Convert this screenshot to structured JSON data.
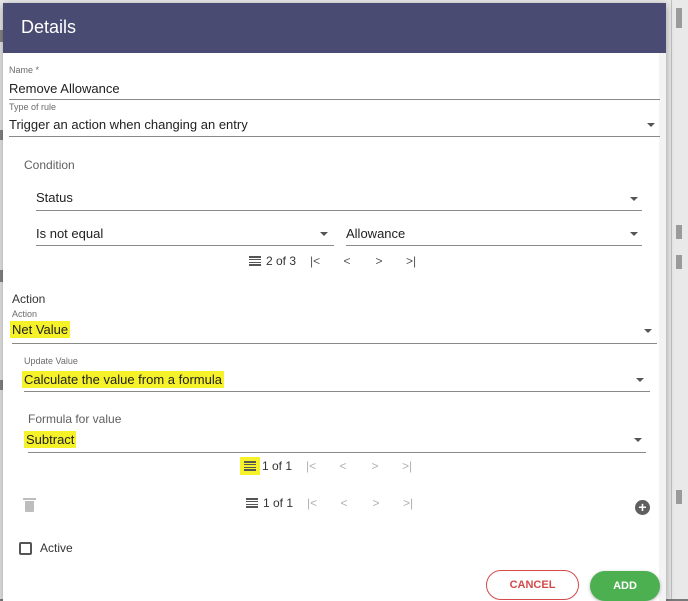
{
  "dialog": {
    "title": "Details",
    "name_label": "Name *",
    "name_value": "Remove Allowance",
    "type_label": "Type of rule",
    "type_value": "Trigger an action when changing an entry"
  },
  "condition": {
    "title": "Condition",
    "field_value": "Status",
    "operator_value": "Is not equal",
    "compare_value": "Allowance",
    "pager": {
      "text": "2 of 3",
      "first": "|<",
      "prev": "<",
      "next": ">",
      "last": ">|"
    }
  },
  "action": {
    "title": "Action",
    "action_label": "Action",
    "action_value": "Net Value",
    "update_label": "Update Value",
    "update_value": "Calculate the value from a formula",
    "formula_title": "Formula for value",
    "formula_value": "Subtract",
    "formula_pager": {
      "text": "1 of 1",
      "first": "|<",
      "prev": "<",
      "next": ">",
      "last": ">|"
    }
  },
  "outer_pager": {
    "text": "1 of 1",
    "first": "|<",
    "prev": "<",
    "next": ">",
    "last": ">|"
  },
  "active_label": "Active",
  "buttons": {
    "cancel": "CANCEL",
    "add": "ADD"
  },
  "colors": {
    "header": "#4a4b72",
    "highlight": "#f6f22a",
    "add": "#4caf50",
    "cancel": "#d44a4a"
  }
}
